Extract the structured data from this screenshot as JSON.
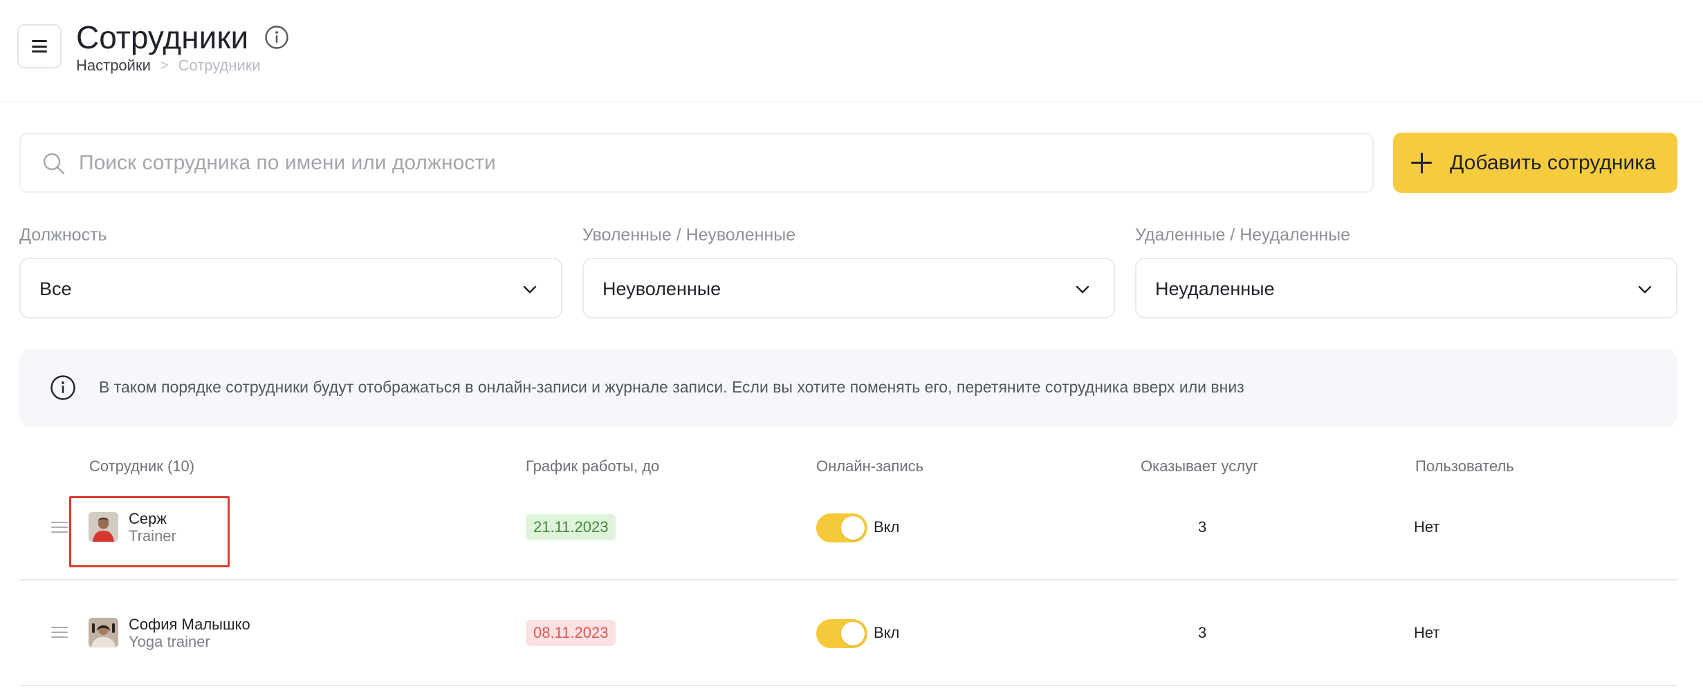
{
  "header": {
    "title": "Сотрудники",
    "breadcrumb": {
      "parent": "Настройки",
      "separator": ">",
      "current": "Сотрудники"
    }
  },
  "search": {
    "placeholder": "Поиск сотрудника по имени или должности",
    "value": ""
  },
  "add_button": {
    "label": "Добавить сотрудника"
  },
  "filters": [
    {
      "label": "Должность",
      "value": "Все"
    },
    {
      "label": "Уволенные / Неуволенные",
      "value": "Неуволенные"
    },
    {
      "label": "Удаленные / Неудаленные",
      "value": "Неудаленные"
    }
  ],
  "info_banner": {
    "text": "В таком порядке сотрудники будут отображаться в онлайн-записи и журнале записи. Если вы хотите поменять его, перетяните сотрудника вверх или вниз"
  },
  "table": {
    "columns": [
      "Сотрудник (10)",
      "График работы, до",
      "Онлайн-запись",
      "Оказывает услуг",
      "Пользователь"
    ],
    "rows": [
      {
        "name": "Серж",
        "role": "Trainer",
        "schedule_until": "21.11.2023",
        "schedule_status": "active",
        "online_booking": true,
        "online_label": "Вкл",
        "services": "3",
        "user": "Нет"
      },
      {
        "name": "София Малышко",
        "role": "Yoga trainer",
        "schedule_until": "08.11.2023",
        "schedule_status": "expired",
        "online_booking": true,
        "online_label": "Вкл",
        "services": "3",
        "user": "Нет"
      }
    ]
  },
  "colors": {
    "accent": "#f6cb3e",
    "badge_active_bg": "#dff3da",
    "badge_active_text": "#3d8a3a",
    "badge_expired_bg": "#fbe2e2",
    "badge_expired_text": "#e05555",
    "highlight_frame": "#d83a2e"
  }
}
